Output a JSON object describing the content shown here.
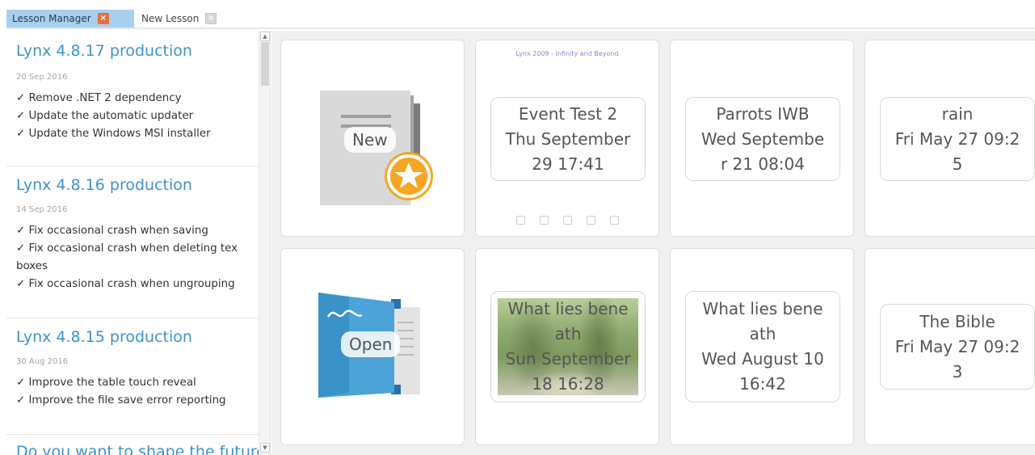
{
  "tabs": [
    {
      "label": "Lesson Manager",
      "close": "×"
    },
    {
      "label": "New Lesson",
      "close": "×"
    }
  ],
  "news": [
    {
      "title": "Lynx 4.8.17 production",
      "date": "20 Sep 2016",
      "lines": [
        "✓ Remove .NET 2 dependency",
        "✓ Update the automatic updater",
        "✓ Update the Windows MSI installer"
      ]
    },
    {
      "title": "Lynx 4.8.16 production",
      "date": "14 Sep 2016",
      "lines": [
        "✓ Fix occasional crash when saving",
        "✓ Fix occasional crash when deleting tex",
        "boxes",
        "✓ Fix occasional crash when ungrouping"
      ]
    },
    {
      "title": "Lynx 4.8.15 production",
      "date": "30 Aug 2016",
      "lines": [
        "✓ Improve the table touch reveal",
        "✓ Improve the file save error reporting"
      ]
    },
    {
      "title": "Do you want to shape the future"
    }
  ],
  "actions": {
    "new_label": "New",
    "open_label": "Open"
  },
  "lessons": [
    {
      "lines": [
        "Event Test 2",
        "Thu September",
        "29 17:41"
      ],
      "preview_header": "Lynx 2009 - Infinity and Beyond"
    },
    {
      "lines": [
        "Parrots IWB",
        "Wed Septembe",
        "r 21 08:04"
      ]
    },
    {
      "lines": [
        "rain",
        "Fri May 27 09:2",
        "5"
      ]
    },
    {
      "lines": [
        "What lies bene",
        "ath",
        "Sun September",
        "18 16:28"
      ]
    },
    {
      "lines": [
        "What lies bene",
        "ath",
        "Wed August 10",
        "16:42"
      ]
    },
    {
      "lines": [
        "The Bible",
        "Fri May 27 09:2",
        "3"
      ]
    }
  ],
  "colors": {
    "accent_blue": "#3e93cc",
    "active_tab": "#a9cfee",
    "new_star": "#f5a623"
  }
}
